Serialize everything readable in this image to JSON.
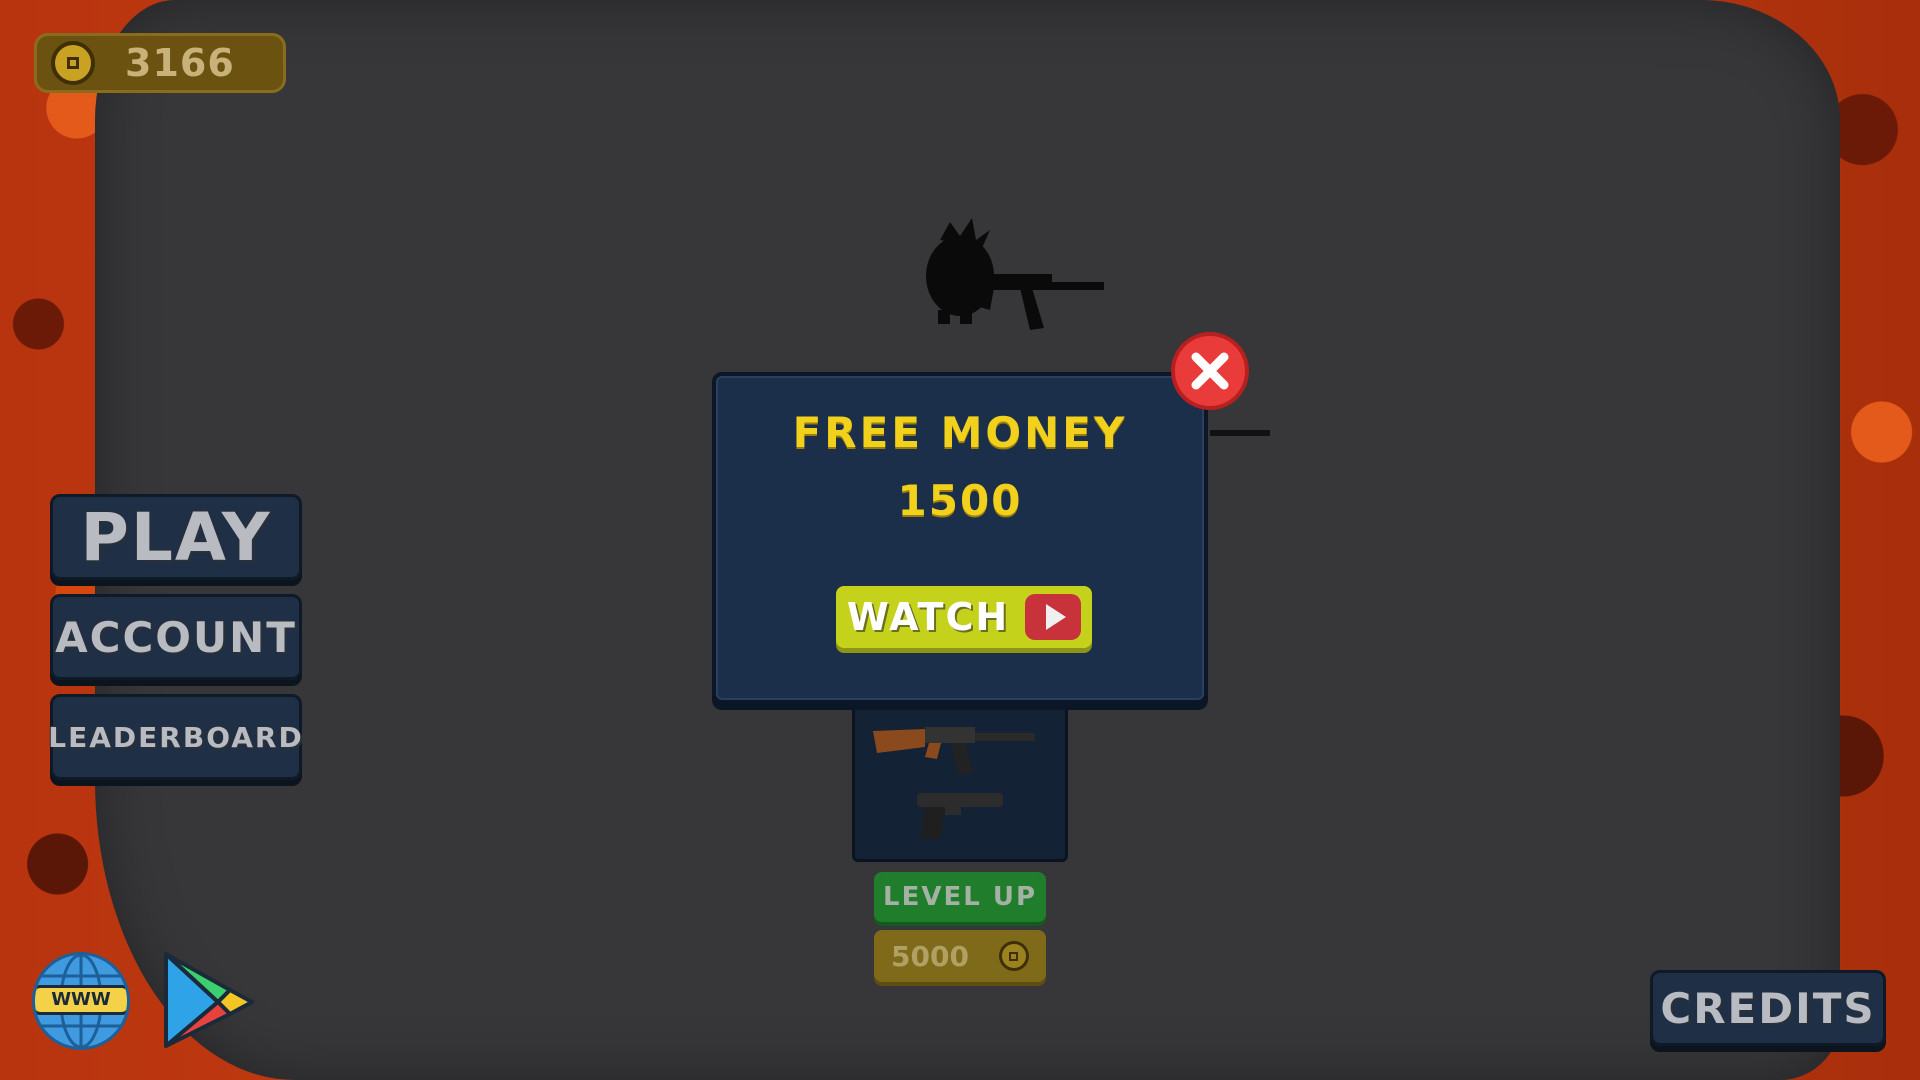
{
  "hud": {
    "coins": "3166"
  },
  "menu": {
    "play_label": "PLAY",
    "account_label": "ACCOUNT",
    "leaderboard_label": "LEADERBOARD",
    "credits_label": "CREDITS"
  },
  "links": {
    "website_label": "WWW"
  },
  "upgrade": {
    "level_up_label": "LEVEL UP",
    "cost": "5000"
  },
  "modal": {
    "title": "FREE MONEY",
    "amount": "1500",
    "watch_label": "WATCH"
  },
  "colors": {
    "accent_yellow": "#f2d11c",
    "close_red": "#ea3b3b",
    "panel_blue": "#1b2e4a",
    "lava": "#b8340f"
  },
  "icons": [
    "coin-icon",
    "globe-icon",
    "google-play-icon",
    "play-video-icon",
    "close-icon",
    "rifle-icon",
    "pistol-icon"
  ]
}
